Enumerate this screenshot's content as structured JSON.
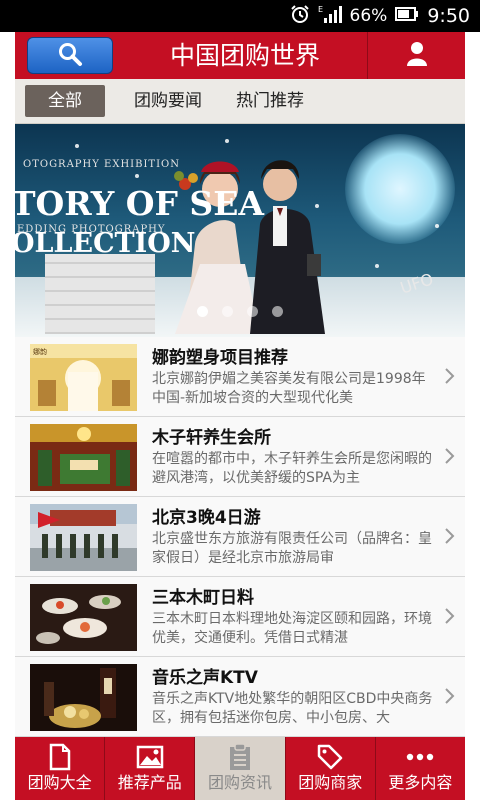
{
  "status_bar": {
    "battery": "66%",
    "time": "9:50"
  },
  "header": {
    "title": "中国团购世界"
  },
  "tabs": [
    {
      "label": "全部",
      "active": true
    },
    {
      "label": "团购要闻",
      "active": false
    },
    {
      "label": "热门推荐",
      "active": false
    }
  ],
  "banner": {
    "line1": "OTOGRAPHY EXHIBITION",
    "line2": "TORY OF SEA",
    "line3": "EDDING PHOTOGRAPHY",
    "line4": "OLLECTION",
    "ufo_text": "UFO",
    "active_slide": 1,
    "slide_count": 4
  },
  "list": [
    {
      "title": "娜韵塑身项目推荐",
      "desc": "北京娜韵伊媚之美容美发有限公司是1998年中国-新加坡合资的大型现代化美"
    },
    {
      "title": "木子轩养生会所",
      "desc": "在喧嚣的都市中，木子轩养生会所是您闲暇的避风港湾，以优美舒缓的SPA为主"
    },
    {
      "title": "北京3晚4日游",
      "desc": "北京盛世东方旅游有限责任公司（品牌名：皇家假日）是经北京市旅游局审"
    },
    {
      "title": "三本木町日料",
      "desc": "三本木町日本料理地处海淀区颐和园路，环境优美，交通便利。凭借日式精湛"
    },
    {
      "title": "音乐之声KTV",
      "desc": "音乐之声KTV地处繁华的朝阳区CBD中央商务区，拥有包括迷你包房、中小包房、大"
    }
  ],
  "bottom_nav": [
    {
      "label": "团购大全",
      "icon": "document-icon",
      "active": false
    },
    {
      "label": "推荐产品",
      "icon": "image-icon",
      "active": false
    },
    {
      "label": "团购资讯",
      "icon": "clipboard-icon",
      "active": true
    },
    {
      "label": "团购商家",
      "icon": "tag-icon",
      "active": false
    },
    {
      "label": "更多内容",
      "icon": "more-dots-icon",
      "active": false
    }
  ],
  "colors": {
    "brand": "#c40f23",
    "tab_active": "#6b625c",
    "search_blue": "#1d63c4"
  }
}
